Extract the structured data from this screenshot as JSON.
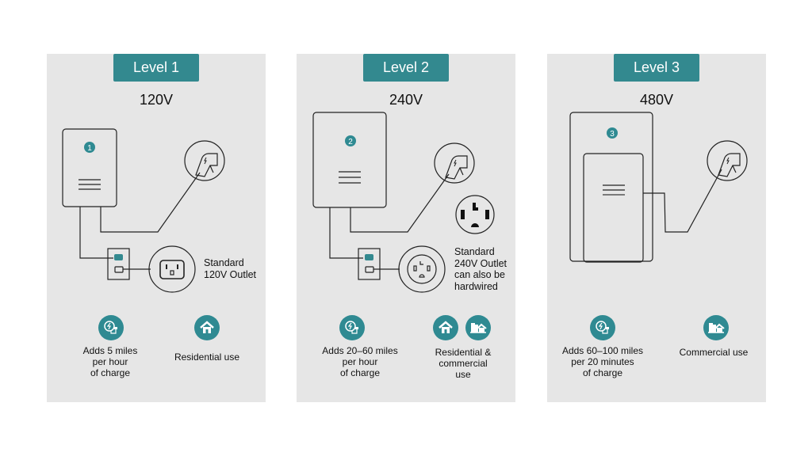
{
  "colors": {
    "accent": "#33898f",
    "panel_bg": "#e6e6e6",
    "line": "#222222"
  },
  "levels": [
    {
      "title": "Level 1",
      "voltage": "120V",
      "unit_number": "1",
      "outlet_label": "Standard\n120V Outlet",
      "features": [
        {
          "icon": "charging-plug-icon",
          "text": "Adds 5 miles\nper hour\nof charge"
        },
        {
          "icon": "house-icon",
          "text": "Residential use"
        }
      ]
    },
    {
      "title": "Level 2",
      "voltage": "240V",
      "unit_number": "2",
      "outlet_label": "Standard\n240V Outlet\ncan also be\nhardwired",
      "features": [
        {
          "icon": "charging-plug-icon",
          "text": "Adds 20–60 miles\nper hour\nof charge"
        },
        {
          "icon": "house-and-commercial-icons",
          "text": "Residential &\ncommercial\nuse"
        }
      ]
    },
    {
      "title": "Level 3",
      "voltage": "480V",
      "unit_number": "3",
      "features": [
        {
          "icon": "charging-plug-icon",
          "text": "Adds 60–100 miles\nper 20 minutes\nof charge"
        },
        {
          "icon": "commercial-building-icon",
          "text": "Commercial use"
        }
      ]
    }
  ]
}
